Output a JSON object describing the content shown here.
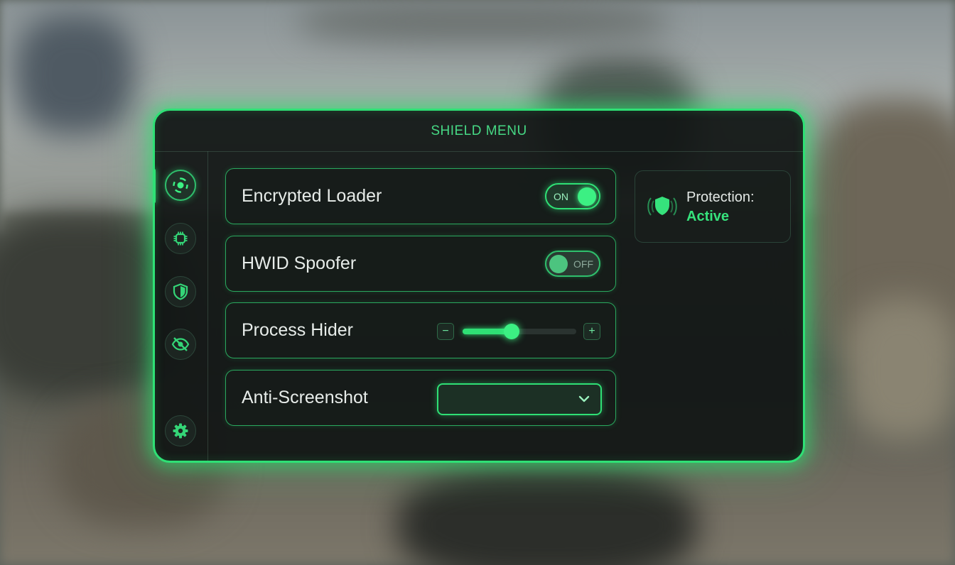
{
  "menu": {
    "title": "SHIELD MENU"
  },
  "sidebar": {
    "items": [
      {
        "icon": "target-icon",
        "active": true
      },
      {
        "icon": "chip-icon",
        "active": false
      },
      {
        "icon": "shield-icon",
        "active": false
      },
      {
        "icon": "eye-off-icon",
        "active": false
      },
      {
        "icon": "gear-icon",
        "active": false
      }
    ]
  },
  "features": {
    "encrypted_loader": {
      "label": "Encrypted Loader",
      "toggle_text": "ON",
      "enabled": true
    },
    "hwid_spoofer": {
      "label": "HWID Spoofer",
      "toggle_text": "OFF",
      "enabled": false
    },
    "process_hider": {
      "label": "Process Hider",
      "decrement": "−",
      "increment": "+",
      "level": 0.43
    },
    "anti_screenshot": {
      "label": "Anti-Screenshot",
      "selected": ""
    }
  },
  "status": {
    "label": "Protection:",
    "value": "Active"
  },
  "colors": {
    "accent": "#2fe075",
    "panel_bg": "#111514",
    "text": "#e7ece9",
    "status_active": "#36e27c"
  }
}
